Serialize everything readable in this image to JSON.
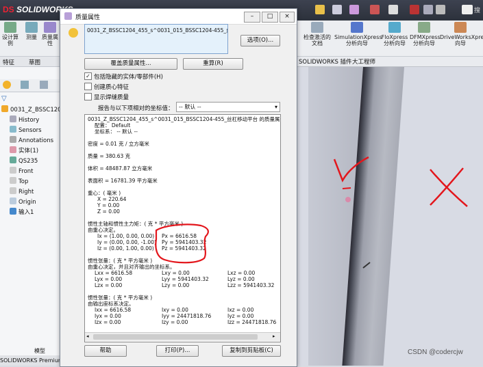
{
  "app": {
    "logo_ds": "DS",
    "logo_text": "SOLIDWORKS",
    "status_bar": "SOLIDWORKS Premium",
    "bottom_tab": "模型"
  },
  "ribbon": {
    "left_buttons": [
      "设计算例",
      "测量",
      "质量属性"
    ],
    "right_buttons": [
      "检查激活的文档",
      "SimulationXpress 分析向导",
      "FloXpress 分析向导",
      "DFMXpress 分析向导",
      "DriveWorksXpress 向导"
    ],
    "search_label": "搜"
  },
  "left_tabs": [
    "特征",
    "草图"
  ],
  "tree": {
    "root": "0031_Z_BSSC1204",
    "items": [
      "History",
      "Sensors",
      "Annotations",
      "实体(1)",
      "QS235",
      "Front",
      "Top",
      "Right",
      "Origin",
      "输入1"
    ]
  },
  "viewport_tabs": [
    "SOLIDWORKS 插件",
    "大工程师"
  ],
  "dialog": {
    "title": "质量属性",
    "selection": "0031_Z_BSSC1204_455_s^0031_015_BSSC1204-455_丝杠移",
    "options_btn": "选项(O)...",
    "override_btn": "覆盖质量属性...",
    "recalc_btn": "重算(R)",
    "check_include": "包括隐藏的实体/零部件(H)",
    "check_features": "创建质心特征",
    "check_weld": "显示焊缝质量",
    "coord_label": "报告与以下项相对的坐标值：",
    "coord_value": "-- 默认 --",
    "help_btn": "帮助",
    "print_btn": "打印(P)...",
    "copy_btn": "复制到剪贴板(C)"
  },
  "results": {
    "header": "0031_Z_BSSC1204_455_s^0031_015_BSSC1204-455_丝杠移动平台 的质量属性",
    "config": "配置：  Default",
    "coordsys": "坐标系： -- 默认 --",
    "density": "密度 = 0.01 克 / 立方毫米",
    "mass": "质量 = 380.63 克",
    "volume": "体积 = 48487.87 立方毫米",
    "area": "表面积 = 16781.39  平方毫米",
    "com_title": "重心：( 毫米 )",
    "com_x": "X = 220.64",
    "com_y": "Y = 0.00",
    "com_z": "Z = 0.00",
    "principal_title": "惯性主轴和惯性主力矩：( 克 *  平方毫米 )",
    "principal_sub": "由重心决定。",
    "ix": "Ix = (1.00,  0.00,  0.00)",
    "iy": "Iy = (0.00,  0.00, -1.00)",
    "iz": "Iz = (0.00,  1.00,  0.00)",
    "px": "Px = 6616.58",
    "py": "Py = 5941403.32",
    "pz": "Pz = 5941403.32",
    "tensor1_title": "惯性张量：( 克 *  平方毫米 )",
    "tensor1_sub": "由重心决定，并且对齐输出的坐标系。",
    "t1": [
      [
        "Lxx = 6616.58",
        "Lxy = 0.00",
        "Lxz = 0.00"
      ],
      [
        "Lyx = 0.00",
        "Lyy = 5941403.32",
        "Lyz = 0.00"
      ],
      [
        "Lzx = 0.00",
        "Lzy = 0.00",
        "Lzz = 5941403.32"
      ]
    ],
    "tensor2_title": "惯性张量：( 克 *  平方毫米 )",
    "tensor2_sub": "由输出座标系决定。",
    "t2": [
      [
        "Ixx = 6616.58",
        "Ixy = 0.00",
        "Ixz = 0.00"
      ],
      [
        "Iyx = 0.00",
        "Iyy = 24471818.76",
        "Iyz = 0.00"
      ],
      [
        "Izx = 0.00",
        "Izy = 0.00",
        "Izz = 24471818.76"
      ]
    ]
  },
  "watermark": "CSDN @codercjw",
  "colors": {
    "topbar": "#2c313b",
    "selection_bg": "#e4f1fb",
    "annotation_red": "#e3161c",
    "viewport_bg": "#d8dbe4"
  }
}
